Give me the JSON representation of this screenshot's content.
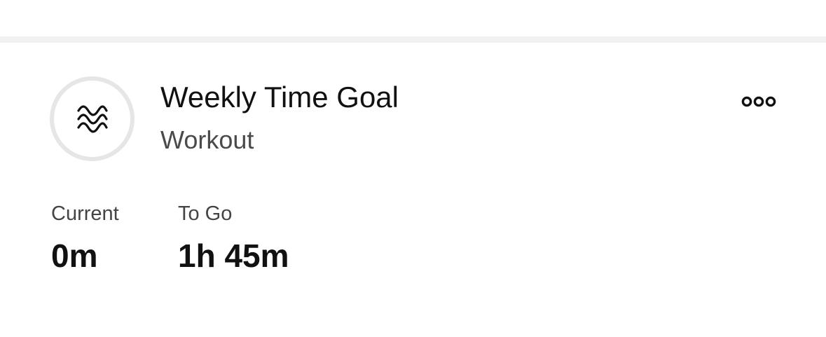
{
  "goal": {
    "title": "Weekly Time Goal",
    "subtitle": "Workout",
    "icon": "activity-waves-icon",
    "progress_fraction": 0
  },
  "menu": {
    "icon": "more-options-icon"
  },
  "stats": {
    "current_label": "Current",
    "current_value": "0m",
    "togo_label": "To Go",
    "togo_value": "1h 45m"
  },
  "colors": {
    "text_primary": "#111111",
    "text_secondary": "#4a4a4a",
    "ring_track": "#e6e6e6",
    "divider": "#f1f1f1",
    "background": "#ffffff"
  }
}
